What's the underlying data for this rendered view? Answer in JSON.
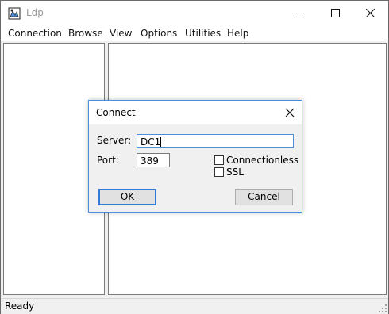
{
  "window": {
    "title": "Ldp"
  },
  "menu": [
    "Connection",
    "Browse",
    "View",
    "Options",
    "Utilities",
    "Help"
  ],
  "status": {
    "text": "Ready"
  },
  "dialog": {
    "title": "Connect",
    "server_label": "Server:",
    "server_value": "DC1",
    "port_label": "Port:",
    "port_value": "389",
    "connectionless_label": "Connectionless",
    "connectionless_checked": false,
    "ssl_label": "SSL",
    "ssl_checked": false,
    "ok_label": "OK",
    "cancel_label": "Cancel"
  },
  "icons": {
    "app": "ldp-app-icon",
    "minimize": "minimize-icon",
    "maximize": "maximize-icon",
    "close": "close-icon",
    "dialog_close": "close-icon"
  },
  "colors": {
    "focus_blue": "#2f7bd6",
    "dialog_border": "#4a8fd8"
  }
}
